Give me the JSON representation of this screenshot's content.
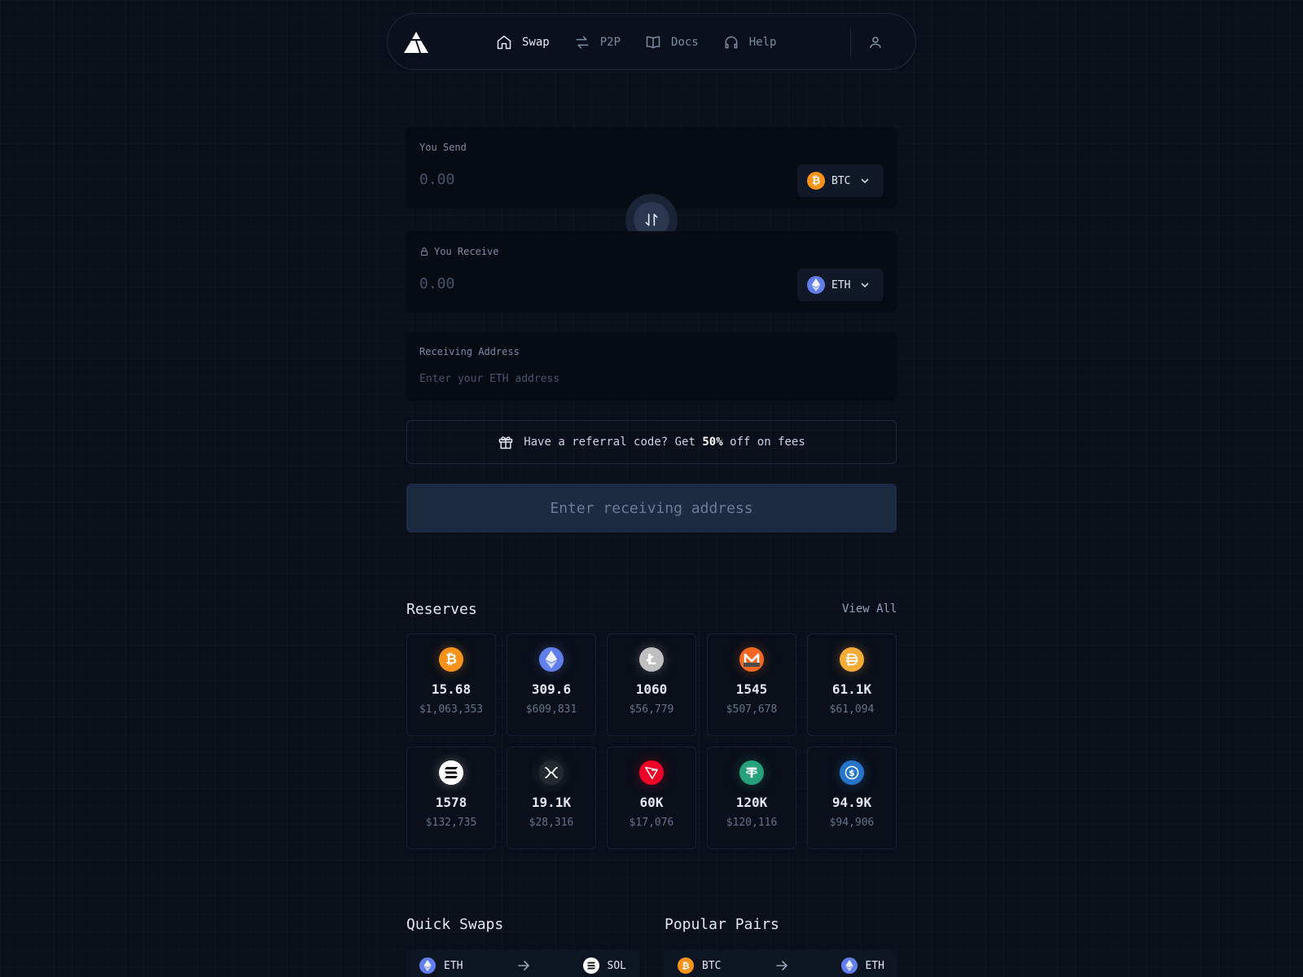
{
  "nav": {
    "links": [
      {
        "label": "Swap",
        "icon": "home-icon"
      },
      {
        "label": "P2P",
        "icon": "arrows-exchange-icon"
      },
      {
        "label": "Docs",
        "icon": "book-icon"
      },
      {
        "label": "Help",
        "icon": "headphones-icon"
      }
    ]
  },
  "send": {
    "label": "You Send",
    "placeholder": "0.00",
    "coin": "BTC"
  },
  "receive": {
    "label": "You Receive",
    "placeholder": "0.00",
    "coin": "ETH"
  },
  "address": {
    "label": "Receiving Address",
    "placeholder": "Enter your ETH address"
  },
  "referral": {
    "text_before": "Have a referral code? Get ",
    "highlight": "50%",
    "text_after": " off on fees"
  },
  "submit_label": "Enter receiving address",
  "reserves": {
    "title": "Reserves",
    "view_all": "View All",
    "items": [
      {
        "coin": "btc",
        "amount": "15.68",
        "usd": "$1,063,353",
        "color": "#f7931a"
      },
      {
        "coin": "eth",
        "amount": "309.6",
        "usd": "$609,831",
        "color": "#627eea"
      },
      {
        "coin": "ltc",
        "amount": "1060",
        "usd": "$56,779",
        "color": "#bfbfbf"
      },
      {
        "coin": "xmr",
        "amount": "1545",
        "usd": "$507,678",
        "color": "#f26822"
      },
      {
        "coin": "dai",
        "amount": "61.1K",
        "usd": "$61,094",
        "color": "#f5ac37"
      },
      {
        "coin": "sol",
        "amount": "1578",
        "usd": "$132,735",
        "color": "#ffffff"
      },
      {
        "coin": "xrp",
        "amount": "19.1K",
        "usd": "$28,316",
        "color": "#23292f"
      },
      {
        "coin": "trx",
        "amount": "60K",
        "usd": "$17,076",
        "color": "#ef0027"
      },
      {
        "coin": "usdt",
        "amount": "120K",
        "usd": "$120,116",
        "color": "#26a17b"
      },
      {
        "coin": "usdc",
        "amount": "94.9K",
        "usd": "$94,906",
        "color": "#2775ca"
      }
    ]
  },
  "quick_swaps": {
    "title": "Quick Swaps",
    "from": "ETH",
    "to": "SOL"
  },
  "popular_pairs": {
    "title": "Popular Pairs",
    "from": "BTC",
    "to": "ETH"
  }
}
